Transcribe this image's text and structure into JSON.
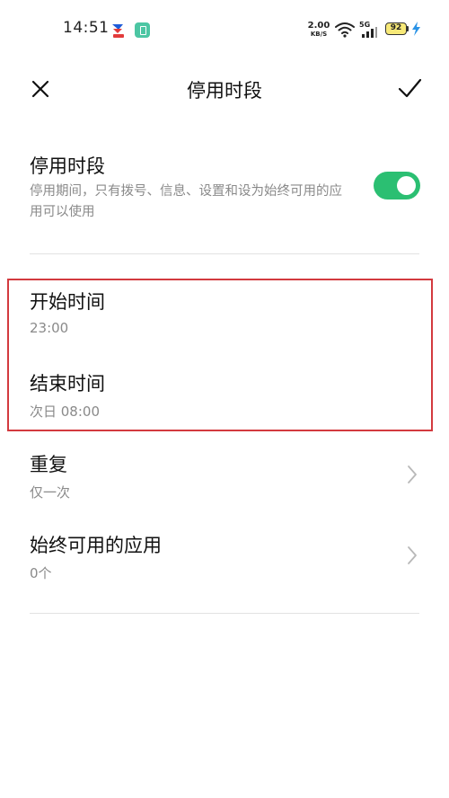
{
  "status_bar": {
    "time": "14:51",
    "net_speed_value": "2.00",
    "net_speed_unit": "KB/S",
    "signal_label": "5G",
    "battery": "92"
  },
  "header": {
    "title": "停用时段",
    "close_icon": "close-icon",
    "confirm_icon": "check-icon"
  },
  "disable_period": {
    "label": "停用时段",
    "description": "停用期间，只有拨号、信息、设置和设为始终可用的应用可以使用",
    "enabled": true,
    "toggle_color": "#2bbf72"
  },
  "schedule": {
    "start": {
      "label": "开始时间",
      "value": "23:00"
    },
    "end": {
      "label": "结束时间",
      "value": "次日 08:00"
    }
  },
  "repeat": {
    "label": "重复",
    "value": "仅一次"
  },
  "allowed_apps": {
    "label": "始终可用的应用",
    "value": "0个"
  },
  "highlight_color": "#d33a3f"
}
